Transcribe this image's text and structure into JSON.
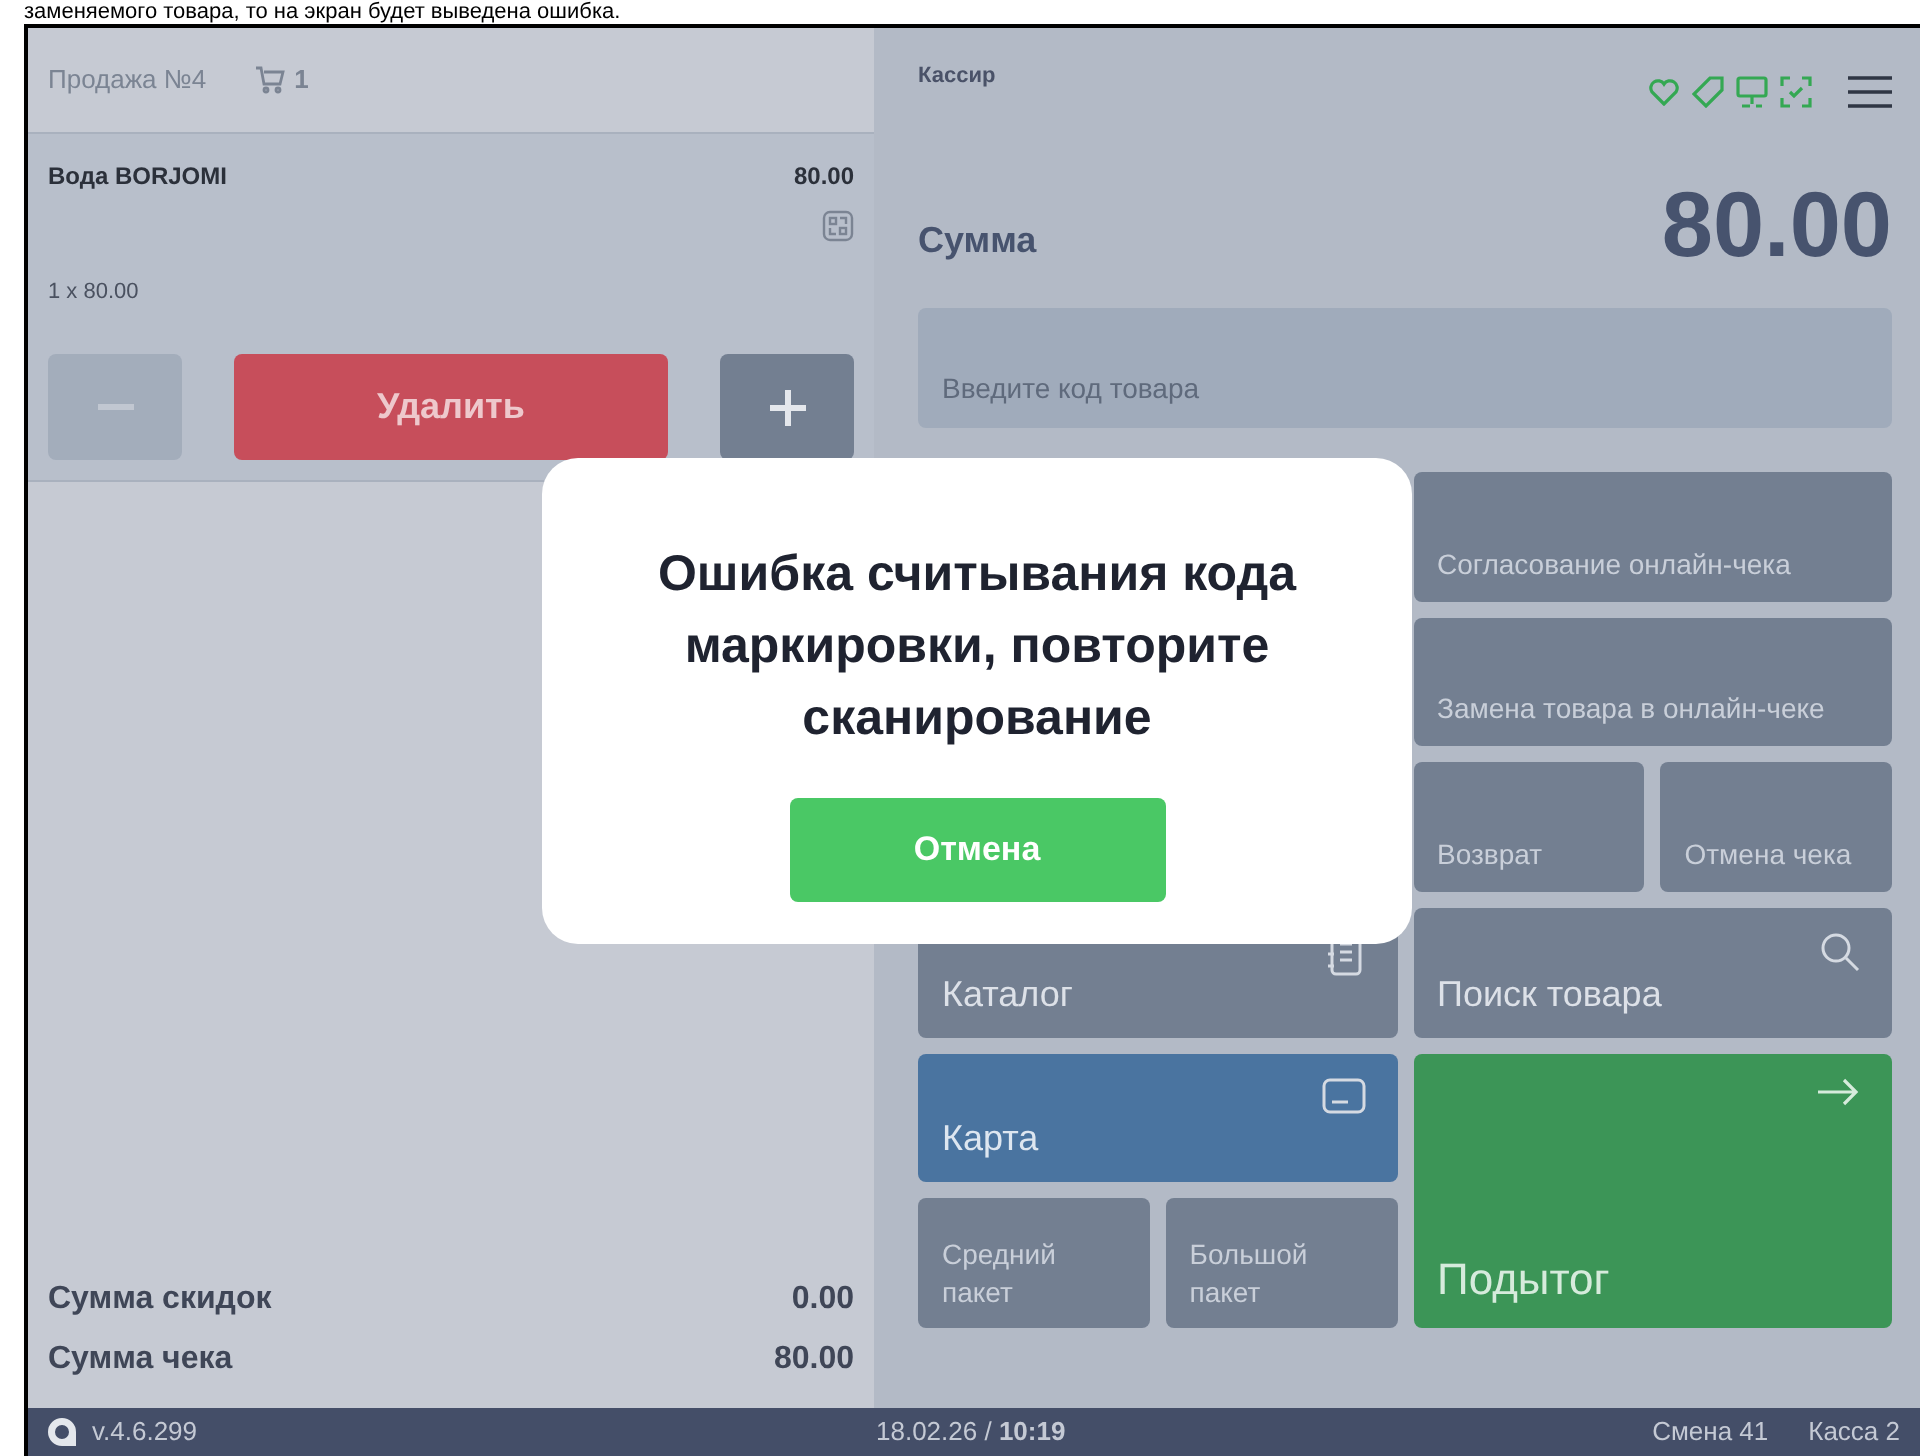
{
  "caption": "заменяемого товара, то на экран будет выведена ошибка.",
  "sale": {
    "title": "Продажа №4",
    "cart_count": "1"
  },
  "item": {
    "name": "Вода BORJOMI",
    "price": "80.00",
    "quantity_line": "1 x 80.00",
    "minus_disabled": true,
    "delete_label": "Удалить"
  },
  "totals": [
    {
      "label": "Сумма скидок",
      "value": "0.00"
    },
    {
      "label": "Сумма чека",
      "value": "80.00"
    }
  ],
  "cashier": "Кассир",
  "sum": {
    "label": "Сумма",
    "value": "80.00"
  },
  "search": {
    "placeholder": "Введите код товара"
  },
  "tiles": [
    {
      "label": "Согласование онлайн-чека",
      "kind": "plain"
    },
    {
      "label": "Замена товара в онлайн-чеке",
      "kind": "plain"
    },
    {
      "label": "Возврат",
      "kind": "plain"
    },
    {
      "label": "Отмена чека",
      "kind": "plain"
    },
    {
      "label": "Каталог",
      "kind": "catalog"
    },
    {
      "label": "Поиск товара",
      "kind": "search"
    },
    {
      "label": "Карта",
      "kind": "card"
    },
    {
      "label": "Средний пакет",
      "kind": "small"
    },
    {
      "label": "Большой пакет",
      "kind": "small"
    },
    {
      "label": "Подытог",
      "kind": "subtotal"
    }
  ],
  "dialog": {
    "message": "Ошибка считывания кода маркировки, повторите сканирование",
    "button": "Отмена"
  },
  "status_bar": {
    "version": "v.4.6.299",
    "datetime": "18.02.26 / **10:19**",
    "shift": "Смена 41",
    "register": "Касса 2"
  }
}
